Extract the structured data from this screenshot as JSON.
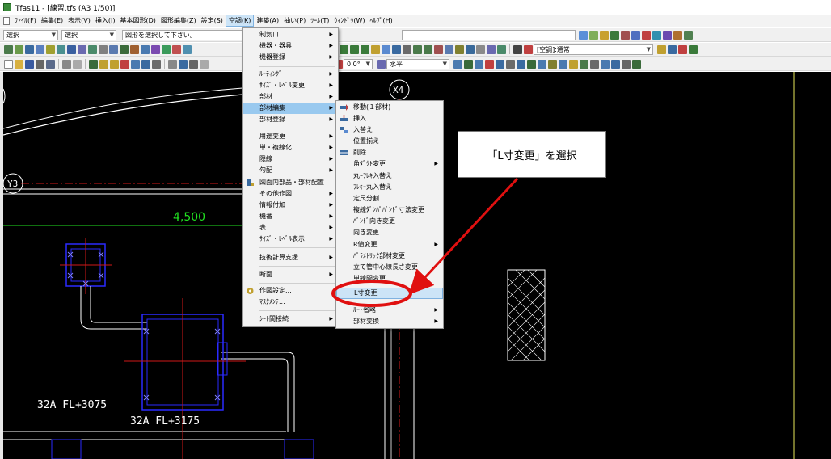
{
  "window": {
    "title": "Tfas11 - [練習.tfs (A3 1/50)]"
  },
  "menubar": {
    "items": [
      "ﾌｧｲﾙ(F)",
      "編集(E)",
      "表示(V)",
      "挿入(I)",
      "基本図形(D)",
      "図形編集(Z)",
      "設定(S)",
      "空調(K)",
      "建築(A)",
      "抽い(P)",
      "ﾂｰﾙ(T)",
      "ｳｨﾝﾄﾞｳ(W)",
      "ﾍﾙﾌﾟ(H)"
    ],
    "active_index": 7
  },
  "toolbar1": {
    "mode1": "選択",
    "mode2": "選択",
    "hint": "図形を選択して下さい。"
  },
  "toolbar2": {
    "layer_combo": "[空調]:通常"
  },
  "toolbar3": {
    "angle": "0.0°",
    "direction": "水平"
  },
  "menu_main": {
    "items": [
      {
        "label": "制気口",
        "sub": true
      },
      {
        "label": "機器・器具",
        "sub": true
      },
      {
        "label": "機器登録",
        "sub": true
      },
      {
        "label": "ﾙｰﾃｨﾝｸﾞ",
        "sub": true
      },
      {
        "label": "ｻｲｽﾞ・ﾚﾍﾞﾙ変更",
        "sub": true
      },
      {
        "label": "部材",
        "sub": true
      },
      {
        "label": "部材編集",
        "sub": true
      },
      {
        "label": "部材登録",
        "sub": true
      },
      {
        "label": "用途変更",
        "sub": true
      },
      {
        "label": "単・複線化",
        "sub": true
      },
      {
        "label": "隠線",
        "sub": true
      },
      {
        "label": "勾配",
        "sub": true
      },
      {
        "label": "図面内部品・部材配置",
        "sub": false
      },
      {
        "label": "その他作図",
        "sub": true
      },
      {
        "label": "情報付加",
        "sub": true
      },
      {
        "label": "機番",
        "sub": true
      },
      {
        "label": "表",
        "sub": true
      },
      {
        "label": "ｻｲｽﾞ・ﾚﾍﾞﾙ表示",
        "sub": true
      },
      {
        "label": "技術計算支援",
        "sub": true
      },
      {
        "label": "断面",
        "sub": true
      },
      {
        "label": "作図設定...",
        "sub": false
      },
      {
        "label": "ﾏｽﾀﾒﾝﾃ...",
        "sub": false
      },
      {
        "label": "ｼｰﾄ間接続",
        "sub": true
      }
    ]
  },
  "menu_sub": {
    "items": [
      {
        "label": "移動(１部材)",
        "sub": false
      },
      {
        "label": "挿入...",
        "sub": false
      },
      {
        "label": "入替え",
        "sub": false
      },
      {
        "label": "位置揃え",
        "sub": false
      },
      {
        "label": "削除",
        "sub": false
      },
      {
        "label": "角ﾀﾞｸﾄ変更",
        "sub": true
      },
      {
        "label": "丸ｰﾌﾚｷ入替え",
        "sub": false
      },
      {
        "label": "ﾌﾚｷｰ丸入替え",
        "sub": false
      },
      {
        "label": "定尺分割",
        "sub": false
      },
      {
        "label": "複線ﾀﾞﾝﾊﾟﾊﾞﾝﾄﾞ寸法変更",
        "sub": false
      },
      {
        "label": "ﾊﾞﾝﾄﾞ向き変更",
        "sub": false
      },
      {
        "label": "向き変更",
        "sub": false
      },
      {
        "label": "R値変更",
        "sub": true
      },
      {
        "label": "ﾊﾟﾗﾒﾄﾘｯｸ部材変更",
        "sub": false
      },
      {
        "label": "立て管中心線長さ変更",
        "sub": false
      },
      {
        "label": "単線間変更",
        "sub": false
      },
      {
        "label": "L寸変更",
        "sub": false
      },
      {
        "label": "ﾙｰﾄ省略",
        "sub": true
      },
      {
        "label": "部材変換",
        "sub": true
      }
    ]
  },
  "callout": {
    "text": "「L寸変更」を選択"
  },
  "drawing": {
    "grid_y3": "Y3",
    "grid_x4": "X4",
    "dimension": "4,500",
    "pipe_label1": "32A  FL+3075",
    "pipe_label2": "32A  FL+3175"
  },
  "colors": {
    "canvas_bg": "#000000",
    "highlight": "#99c9ef",
    "annotation_red": "#e01010",
    "pipe_white": "#ffffff",
    "equipment_blue": "#2a2aff",
    "gridline_red": "#d01818",
    "dimension_green": "#20e020",
    "gridline_yellow": "#e8e85a"
  }
}
